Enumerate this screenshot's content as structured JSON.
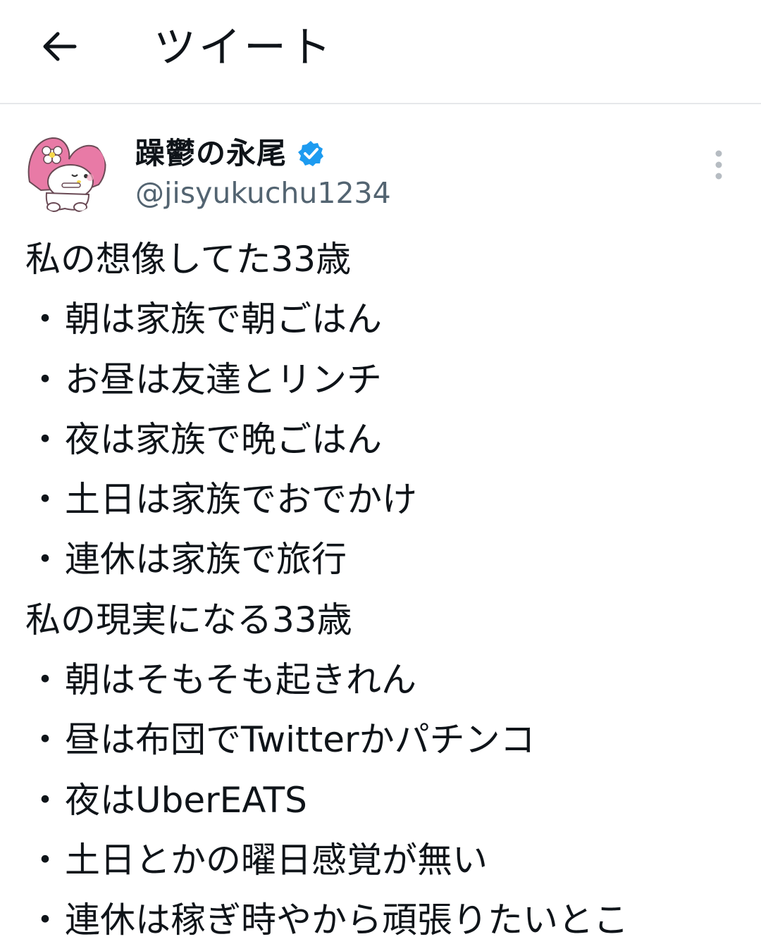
{
  "header": {
    "back_icon": "arrow-left-icon",
    "title": "ツイート"
  },
  "tweet": {
    "author": {
      "display_name": "躁鬱の永尾",
      "verified_icon": "verified-badge-icon",
      "verified_color": "#1d9bf0",
      "handle": "@jisyukuchu1234",
      "avatar_icon": "my-melody-avatar"
    },
    "more_icon": "more-vertical-icon",
    "lines": [
      {
        "text": "私の想像してた33歳",
        "item": false
      },
      {
        "text": "朝は家族で朝ごはん",
        "item": true
      },
      {
        "text": "お昼は友達とリンチ",
        "item": true
      },
      {
        "text": "夜は家族で晩ごはん",
        "item": true
      },
      {
        "text": "土日は家族でおでかけ",
        "item": true
      },
      {
        "text": "連休は家族で旅行",
        "item": true
      },
      {
        "text": "私の現実になる33歳",
        "item": false
      },
      {
        "text": "朝はそもそも起きれん",
        "item": true
      },
      {
        "text": "昼は布団でTwitterかパチンコ",
        "item": true
      },
      {
        "text": "夜はUberEATS",
        "item": true
      },
      {
        "text": "土日とかの曜日感覚が無い",
        "item": true
      },
      {
        "text": "連休は稼ぎ時やから頑張りたいとこ",
        "item": true
      }
    ]
  },
  "colors": {
    "text": "#0f1419",
    "secondary": "#536471",
    "divider": "#e6e8ea",
    "melody_pink": "#e87aa6"
  }
}
